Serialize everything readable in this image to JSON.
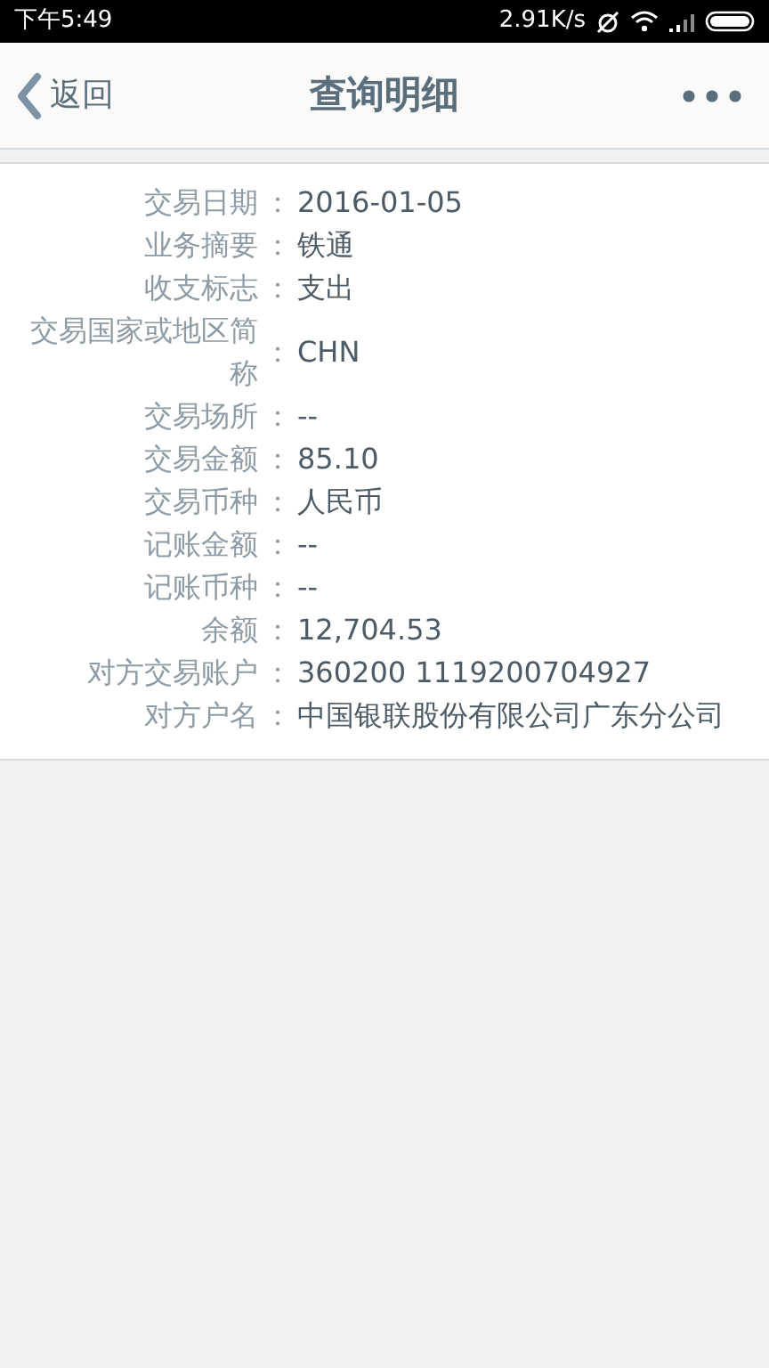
{
  "status_bar": {
    "time": "下午5:49",
    "net_speed": "2.91K/s"
  },
  "header": {
    "back": "返回",
    "title": "查询明细"
  },
  "details": [
    {
      "label": "交易日期",
      "colon": "：",
      "value": "2016-01-05"
    },
    {
      "label": "业务摘要",
      "colon": "：",
      "value": "铁通"
    },
    {
      "label": "收支标志",
      "colon": "：",
      "value": "支出"
    },
    {
      "label": "交易国家或地区简称",
      "colon": "：",
      "value": "CHN"
    },
    {
      "label": "交易场所",
      "colon": "：",
      "value": "--"
    },
    {
      "label": "交易金额",
      "colon": "：",
      "value": "85.10"
    },
    {
      "label": "交易币种",
      "colon": "：",
      "value": "人民币"
    },
    {
      "label": "记账金额",
      "colon": "：",
      "value": "--"
    },
    {
      "label": "记账币种",
      "colon": "：",
      "value": "--"
    },
    {
      "label": "余额",
      "colon": "：",
      "value": "12,704.53"
    },
    {
      "label": "对方交易账户",
      "colon": "：",
      "value": "360200 1119200704927"
    },
    {
      "label": "对方户名",
      "colon": "：",
      "value": "中国银联股份有限公司广东分公司"
    }
  ]
}
